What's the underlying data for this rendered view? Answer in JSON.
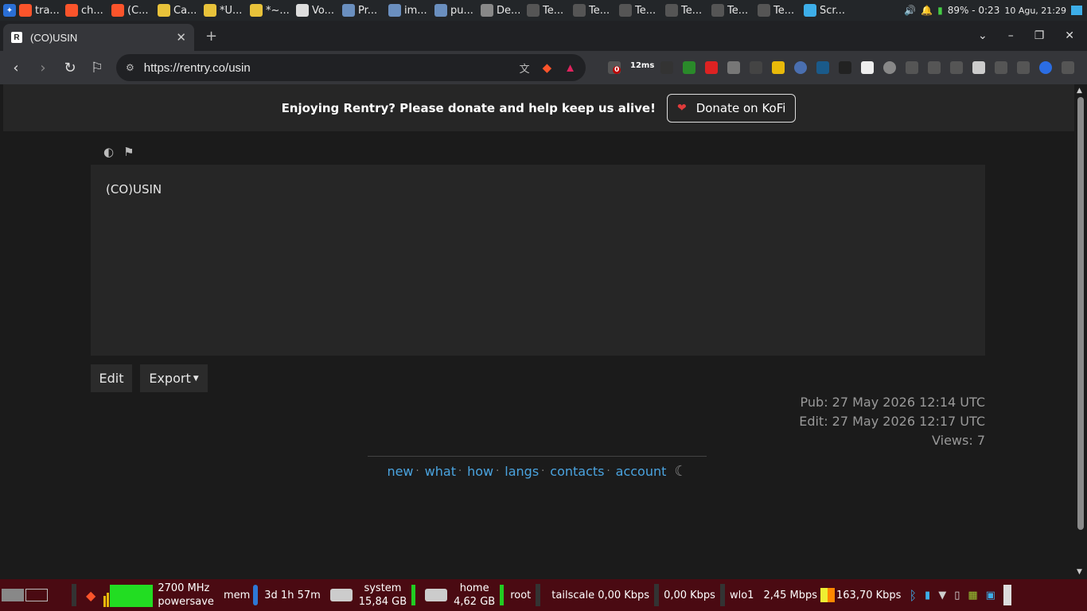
{
  "topbar": {
    "tasks": [
      {
        "label": "tra...",
        "icon": "brave-icon"
      },
      {
        "label": "ch...",
        "icon": "brave-icon"
      },
      {
        "label": "(C...",
        "icon": "brave-icon"
      },
      {
        "label": "Ca...",
        "icon": "note-icon"
      },
      {
        "label": "*U...",
        "icon": "note-icon"
      },
      {
        "label": "*~...",
        "icon": "note-icon"
      },
      {
        "label": "Vo...",
        "icon": "mouse-icon"
      },
      {
        "label": "Pr...",
        "icon": "folder-icon"
      },
      {
        "label": "im...",
        "icon": "folder-icon"
      },
      {
        "label": "pu...",
        "icon": "folder-icon"
      },
      {
        "label": "De...",
        "icon": "app-icon"
      },
      {
        "label": "Te...",
        "icon": "terminal-icon"
      },
      {
        "label": "Te...",
        "icon": "terminal-icon"
      },
      {
        "label": "Te...",
        "icon": "terminal-icon"
      },
      {
        "label": "Te...",
        "icon": "terminal-icon"
      },
      {
        "label": "Te...",
        "icon": "terminal-icon"
      },
      {
        "label": "Te...",
        "icon": "terminal-icon"
      },
      {
        "label": "Scr...",
        "icon": "screenshot-icon"
      }
    ],
    "battery": "89% - 0:23",
    "clock": "10 Agu, 21:29"
  },
  "tab": {
    "title": "(CO)USIN",
    "favicon": "R"
  },
  "omnibox": {
    "url": "https://rentry.co/usin"
  },
  "extensions": {
    "ping_badge": "12ms",
    "counter_badge": "0"
  },
  "banner": {
    "message": "Enjoying Rentry? Please donate and help keep us alive!",
    "donate_label": "Donate on KoFi"
  },
  "paper": {
    "text": "(CO)USIN"
  },
  "actions": {
    "edit_label": "Edit",
    "export_label": "Export"
  },
  "meta": {
    "pub": "Pub: 27 May 2026 12:14 UTC",
    "edit": "Edit: 27 May 2026 12:17 UTC",
    "views": "Views: 7"
  },
  "footer": {
    "links": [
      "new",
      "what",
      "how",
      "langs",
      "contacts",
      "account"
    ]
  },
  "taskbar": {
    "cpu_freq": "2700 MHz",
    "governor": "powersave",
    "mem": "mem",
    "uptime": "3d 1h 57m",
    "disk_system_label": "system",
    "disk_system_size": "15,84 GB",
    "disk_home_label": "home",
    "disk_home_size": "4,62 GB",
    "root_label": "root",
    "tailscale": "tailscale 0,00 Kbps",
    "tailscale_up": "0,00 Kbps",
    "wlo_label": "wlo1",
    "wlo_down": "2,45 Mbps",
    "wlo_up": "163,70 Kbps"
  },
  "colors": {
    "link": "#4aa3df",
    "heart": "#e03b3b",
    "taskbar_bg": "#4a0a12",
    "cpu_graph": "#22dd22"
  }
}
